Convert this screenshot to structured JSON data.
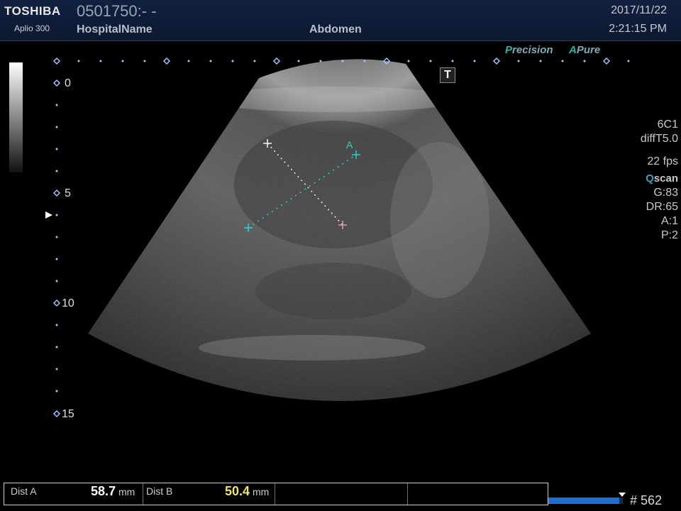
{
  "header": {
    "brand": "TOSHIBA",
    "model": "Aplio 300",
    "patient_id": "0501750:- -",
    "hospital": "HospitalName",
    "preset": "Abdomen",
    "date": "2017/11/22",
    "time": "2:21:15 PM"
  },
  "badges": {
    "precision_letter": "P",
    "precision_rest": "recision",
    "apure_letter": "A",
    "apure_rest": "Pure",
    "t_button": "T"
  },
  "params": {
    "probe": "6C1",
    "mode": "diffT5.0",
    "fps": "22 fps",
    "qscan_q": "Q",
    "qscan_rest": "scan",
    "gain": "G:83",
    "dr": "DR:65",
    "a": "A:1",
    "p": "P:2"
  },
  "depth_scale": {
    "labels": [
      "0",
      "5",
      "10",
      "15"
    ]
  },
  "caliper": {
    "label_a": "A"
  },
  "measurements": {
    "dist_a_label": "Dist A",
    "dist_a_value": "58.7",
    "dist_a_unit": "mm",
    "dist_b_label": "Dist B",
    "dist_b_value": "50.4",
    "dist_b_unit": "mm"
  },
  "cine": {
    "frame": "# 562",
    "progress_fraction": 0.95
  },
  "colors": {
    "accent_cyan": "#2ab3a8",
    "caliper_cyan": "#2ad0d0",
    "header_bg": "#10213f",
    "value_yellow": "#f0e36a"
  }
}
